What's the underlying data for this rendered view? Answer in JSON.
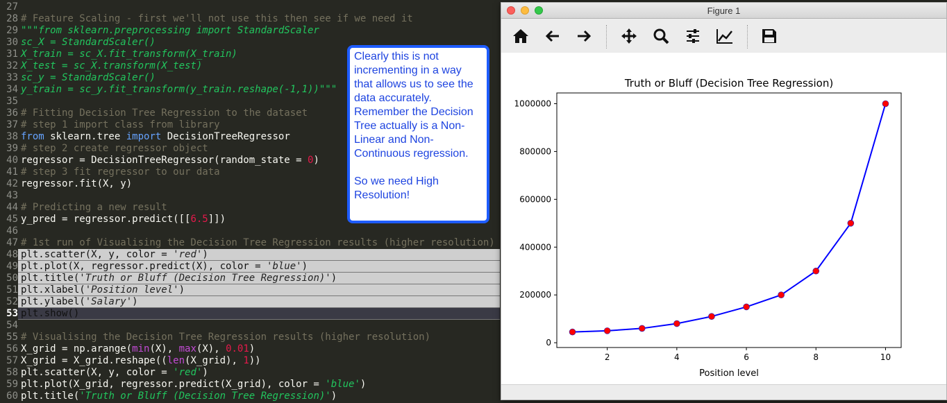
{
  "editor": {
    "lines": [
      {
        "n": "27",
        "parts": []
      },
      {
        "n": "28",
        "parts": [
          [
            "cm",
            "# Feature Scaling - first we'll not use this then see if we need it"
          ]
        ]
      },
      {
        "n": "29",
        "parts": [
          [
            "doc",
            "\"\"\"from sklearn.preprocessing import StandardScaler"
          ]
        ]
      },
      {
        "n": "30",
        "parts": [
          [
            "doc",
            "sc_X = StandardScaler()"
          ]
        ]
      },
      {
        "n": "31",
        "parts": [
          [
            "doc",
            "X_train = sc_X.fit_transform(X_train)"
          ]
        ]
      },
      {
        "n": "32",
        "parts": [
          [
            "doc",
            "X_test = sc_X.transform(X_test)"
          ]
        ]
      },
      {
        "n": "33",
        "parts": [
          [
            "doc",
            "sc_y = StandardScaler()"
          ]
        ]
      },
      {
        "n": "34",
        "parts": [
          [
            "doc",
            "y_train = sc_y.fit_transform(y_train.reshape(-1,1))\"\"\""
          ]
        ]
      },
      {
        "n": "35",
        "parts": []
      },
      {
        "n": "36",
        "parts": [
          [
            "cm",
            "# Fitting Decision Tree Regression to the dataset"
          ]
        ]
      },
      {
        "n": "37",
        "parts": [
          [
            "cm",
            "# step 1 import class from library"
          ]
        ]
      },
      {
        "n": "38",
        "parts": [
          [
            "kw",
            "from"
          ],
          [
            "",
            " sklearn.tree "
          ],
          [
            "kw",
            "import"
          ],
          [
            "",
            " DecisionTreeRegressor"
          ]
        ]
      },
      {
        "n": "39",
        "parts": [
          [
            "cm",
            "# step 2 create regressor object"
          ]
        ]
      },
      {
        "n": "40",
        "parts": [
          [
            "",
            "regressor = DecisionTreeRegressor(random_state = "
          ],
          [
            "num",
            "0"
          ],
          [
            "",
            ")"
          ]
        ]
      },
      {
        "n": "41",
        "parts": [
          [
            "cm",
            "# step 3 fit regressor to our data"
          ]
        ]
      },
      {
        "n": "42",
        "parts": [
          [
            "",
            "regressor.fit(X, y)"
          ]
        ]
      },
      {
        "n": "43",
        "parts": []
      },
      {
        "n": "44",
        "parts": [
          [
            "cm",
            "# Predicting a new result"
          ]
        ]
      },
      {
        "n": "45",
        "parts": [
          [
            "",
            "y_pred = regressor.predict([["
          ],
          [
            "num",
            "6.5"
          ],
          [
            "",
            "]])"
          ]
        ]
      },
      {
        "n": "46",
        "parts": []
      },
      {
        "n": "47",
        "parts": [
          [
            "cm",
            "# 1st run of Visualising the Decision Tree Regression results (higher resolution)"
          ]
        ]
      },
      {
        "n": "48",
        "sel": true,
        "parts": [
          [
            "",
            "plt.scatter(X, y, color = "
          ],
          [
            "strs",
            "'red'"
          ],
          [
            "",
            ")"
          ]
        ]
      },
      {
        "n": "49",
        "sel": true,
        "parts": [
          [
            "",
            "plt.plot(X, regressor.predict(X), color = "
          ],
          [
            "strs",
            "'blue'"
          ],
          [
            "",
            ")"
          ]
        ]
      },
      {
        "n": "50",
        "sel": true,
        "parts": [
          [
            "",
            "plt.title("
          ],
          [
            "strs",
            "'Truth or Bluff (Decision Tree Regression)'"
          ],
          [
            "",
            ")"
          ]
        ]
      },
      {
        "n": "51",
        "sel": true,
        "parts": [
          [
            "",
            "plt.xlabel("
          ],
          [
            "strs",
            "'Position level'"
          ],
          [
            "",
            ")"
          ]
        ]
      },
      {
        "n": "52",
        "sel": true,
        "parts": [
          [
            "",
            "plt.ylabel("
          ],
          [
            "strs",
            "'Salary'"
          ],
          [
            "",
            ")"
          ]
        ]
      },
      {
        "n": "53",
        "sel": true,
        "cur": true,
        "parts": [
          [
            "",
            "plt.show()"
          ]
        ]
      },
      {
        "n": "54",
        "parts": []
      },
      {
        "n": "55",
        "parts": [
          [
            "cm",
            "# Visualising the Decision Tree Regression results (higher resolution)"
          ]
        ]
      },
      {
        "n": "56",
        "parts": [
          [
            "",
            "X_grid = np.arange("
          ],
          [
            "fn",
            "min"
          ],
          [
            "",
            "(X), "
          ],
          [
            "fn",
            "max"
          ],
          [
            "",
            "(X), "
          ],
          [
            "num",
            "0.01"
          ],
          [
            "",
            ")"
          ]
        ]
      },
      {
        "n": "57",
        "parts": [
          [
            "",
            "X_grid = X_grid.reshape(("
          ],
          [
            "fn",
            "len"
          ],
          [
            "",
            "(X_grid), "
          ],
          [
            "num",
            "1"
          ],
          [
            "",
            "))"
          ]
        ]
      },
      {
        "n": "58",
        "parts": [
          [
            "",
            "plt.scatter(X, y, color = "
          ],
          [
            "strg",
            "'red'"
          ],
          [
            "",
            ")"
          ]
        ]
      },
      {
        "n": "59",
        "parts": [
          [
            "",
            "plt.plot(X_grid, regressor.predict(X_grid), color = "
          ],
          [
            "strg",
            "'blue'"
          ],
          [
            "",
            ")"
          ]
        ]
      },
      {
        "n": "60",
        "parts": [
          [
            "",
            "plt.title("
          ],
          [
            "strg",
            "'Truth or Bluff (Decision Tree Regression)'"
          ],
          [
            "",
            ")"
          ]
        ]
      }
    ]
  },
  "callout": {
    "para1": "Clearly this is not incrementing in a way that allows us to see the data accurately. Remember the Decision Tree actually is a Non-Linear and Non-Continuous regression.",
    "para2": "So we need High Resolution!"
  },
  "figure_window": {
    "title": "Figure 1",
    "toolbar": [
      "home-icon",
      "back-icon",
      "forward-icon",
      "pan-icon",
      "zoom-icon",
      "configure-subplots-icon",
      "edit-axis-icon",
      "save-icon"
    ]
  },
  "chart_data": {
    "type": "line",
    "title": "Truth or Bluff (Decision Tree Regression)",
    "xlabel": "Position level",
    "ylabel": "",
    "xlim": [
      0.55,
      10.45
    ],
    "ylim": [
      -20000,
      1045000
    ],
    "xticks": [
      2,
      4,
      6,
      8,
      10
    ],
    "yticks": [
      0,
      200000,
      400000,
      600000,
      800000,
      1000000
    ],
    "grid": false,
    "series": [
      {
        "kind": "line",
        "color": "#0000ff",
        "x": [
          1,
          2,
          3,
          4,
          5,
          6,
          7,
          8,
          9,
          10
        ],
        "y": [
          45000,
          50000,
          60000,
          80000,
          110000,
          150000,
          200000,
          300000,
          500000,
          1000000
        ]
      },
      {
        "kind": "scatter",
        "color": "#ff0000",
        "x": [
          1,
          2,
          3,
          4,
          5,
          6,
          7,
          8,
          9,
          10
        ],
        "y": [
          45000,
          50000,
          60000,
          80000,
          110000,
          150000,
          200000,
          300000,
          500000,
          1000000
        ]
      }
    ]
  }
}
